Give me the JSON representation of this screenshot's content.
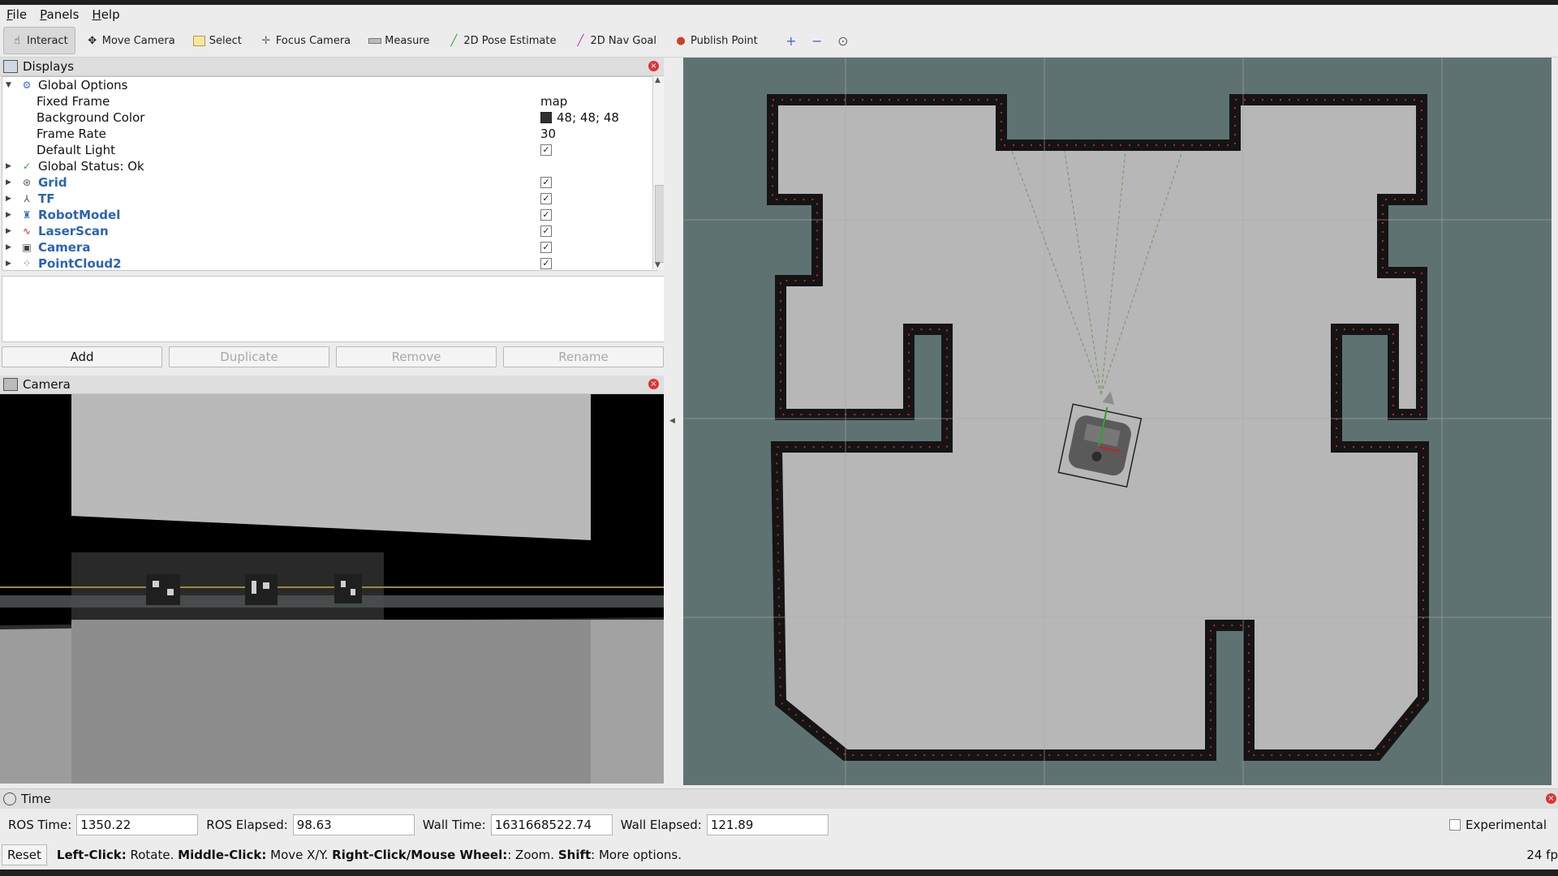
{
  "menubar": {
    "items": [
      {
        "key": "F",
        "rest": "ile"
      },
      {
        "key": "P",
        "rest": "anels"
      },
      {
        "key": "H",
        "rest": "elp"
      }
    ]
  },
  "toolbar": {
    "tools": [
      {
        "label": "Interact",
        "icon": "hand-icon",
        "active": true
      },
      {
        "label": "Move Camera",
        "icon": "move-camera-icon",
        "active": false
      },
      {
        "label": "Select",
        "icon": "select-icon",
        "active": false
      },
      {
        "label": "Focus Camera",
        "icon": "focus-camera-icon",
        "active": false
      },
      {
        "label": "Measure",
        "icon": "ruler-icon",
        "active": false
      },
      {
        "label": "2D Pose Estimate",
        "icon": "green-arrow-icon",
        "active": false
      },
      {
        "label": "2D Nav Goal",
        "icon": "magenta-arrow-icon",
        "active": false
      },
      {
        "label": "Publish Point",
        "icon": "pin-icon",
        "active": false
      }
    ],
    "zoom": [
      "+",
      "−",
      "⊙"
    ]
  },
  "displays": {
    "title": "Displays",
    "global_options": "Global Options",
    "fixed_frame_label": "Fixed Frame",
    "fixed_frame_value": "map",
    "bg_color_label": "Background Color",
    "bg_color_value": "48; 48; 48",
    "frame_rate_label": "Frame Rate",
    "frame_rate_value": "30",
    "default_light_label": "Default Light",
    "global_status": "Global Status: Ok",
    "items": [
      {
        "name": "Grid",
        "icon": "grid-icon"
      },
      {
        "name": "TF",
        "icon": "tf-icon"
      },
      {
        "name": "RobotModel",
        "icon": "robot-model-icon"
      },
      {
        "name": "LaserScan",
        "icon": "laser-scan-icon"
      },
      {
        "name": "Camera",
        "icon": "camera-icon"
      },
      {
        "name": "PointCloud2",
        "icon": "point-cloud-icon"
      }
    ],
    "buttons": {
      "add": "Add",
      "duplicate": "Duplicate",
      "remove": "Remove",
      "rename": "Rename"
    }
  },
  "camera_panel": {
    "title": "Camera"
  },
  "time_panel": {
    "title": "Time",
    "ros_time_label": "ROS Time:",
    "ros_time": "1350.22",
    "ros_elapsed_label": "ROS Elapsed:",
    "ros_elapsed": "98.63",
    "wall_time_label": "Wall Time:",
    "wall_time": "1631668522.74",
    "wall_elapsed_label": "Wall Elapsed:",
    "wall_elapsed": "121.89",
    "experimental": "Experimental"
  },
  "status": {
    "reset": "Reset",
    "left_click": "Left-Click:",
    "left_click_desc": " Rotate. ",
    "middle_click": "Middle-Click:",
    "middle_click_desc": " Move X/Y. ",
    "right_click": "Right-Click/Mouse Wheel:",
    "right_click_desc": ": Zoom. ",
    "shift": "Shift",
    "shift_desc": ": More options.",
    "fps": "24 fp"
  }
}
